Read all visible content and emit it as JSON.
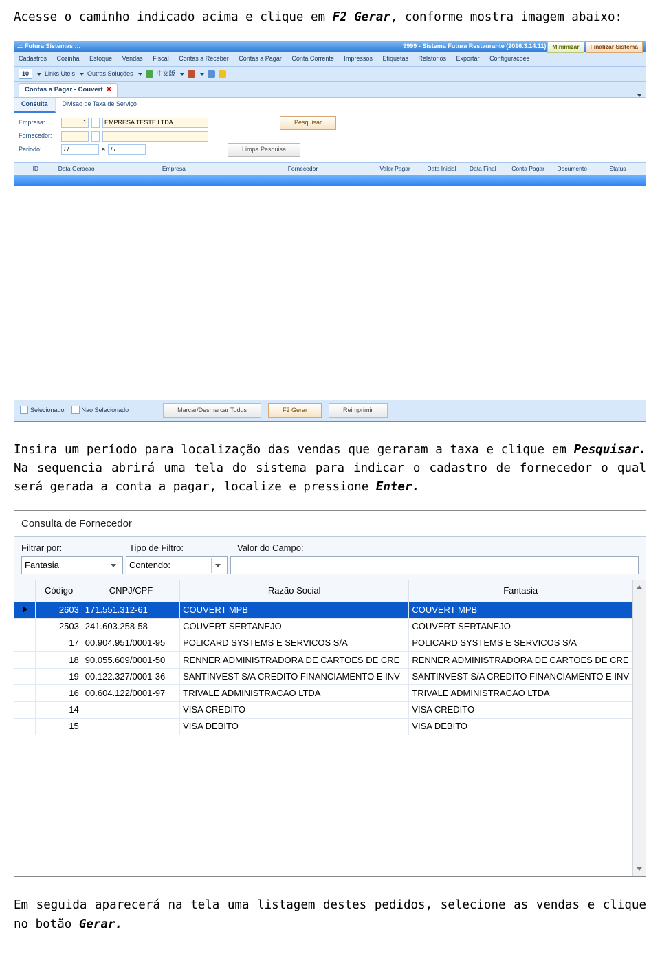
{
  "para1_a": "Acesse o caminho indicado acima e clique em ",
  "para1_b": "F2 Gerar",
  "para1_c": ", conforme mostra imagem abaixo:",
  "para2_a": "Insira um período para localização das vendas que geraram a taxa e clique em ",
  "para2_b": "Pesquisar.",
  "para2_c": " Na sequencia abrirá uma tela do sistema para indicar o cadastro de fornecedor o qual será gerada a conta a pagar, localize e pressione ",
  "para2_d": "Enter.",
  "para3_a": "Em seguida aparecerá na tela uma listagem destes pedidos, selecione as vendas e clique no botão ",
  "para3_b": "Gerar.",
  "app1": {
    "titleLeft": ".:: Futura Sistemas ::.",
    "titleRight": "9999 - Sistema Futura Restaurante (2016.3.14.11)",
    "btnMin": "Minimizar",
    "btnFin": "Finalizar Sistema",
    "menu": [
      "Cadastros",
      "Cozinha",
      "Estoque",
      "Vendas",
      "Fiscal",
      "Contas a Receber",
      "Contas a Pagar",
      "Conta Corrente",
      "Impressos",
      "Etiquetas",
      "Relatorios",
      "Exportar",
      "Configuracoes"
    ],
    "tbNum": "10",
    "tbLinks": "Links Uteis",
    "tbOutras": "Outras Soluções",
    "tbLang": "中文版",
    "tabLabel": "Contas a Pagar - Couvert",
    "subtabs": [
      "Consulta",
      "Divisao de Taxa de Serviço"
    ],
    "lblEmpresa": "Empresa:",
    "valEmpresaId": "1",
    "valEmpresa": "EMPRESA TESTE LTDA",
    "lblForn": "Fornecedor:",
    "lblPeriodo": "Periodo:",
    "valDate1": "/  /",
    "lblA": "a",
    "valDate2": "/  /",
    "btnPesq": "Pesquisar",
    "btnLimpa": "Limpa Pesquisa",
    "gridCols": [
      "ID",
      "Data Geracao",
      "Empresa",
      "Fornecedor",
      "Valor Pagar",
      "Data Inicial",
      "Data Final",
      "Conta Pagar",
      "Documento",
      "Status"
    ],
    "chkSel": "Selecionado",
    "chkNao": "Nao Selecionado",
    "btnMarcar": "Marcar/Desmarcar Todos",
    "btnGerar": "F2 Gerar",
    "btnReimp": "Reimprimir"
  },
  "app2": {
    "title": "Consulta de Fornecedor",
    "lblFiltrar": "Filtrar por:",
    "lblTipo": "Tipo de Filtro:",
    "lblValor": "Valor do Campo:",
    "combo1": "Fantasia",
    "combo2": "Contendo:",
    "cols": [
      "Código",
      "CNPJ/CPF",
      "Razão Social",
      "Fantasia"
    ],
    "rows": [
      {
        "code": "2603",
        "doc": "171.551.312-61",
        "rs": "COUVERT MPB",
        "fan": "COUVERT MPB"
      },
      {
        "code": "2503",
        "doc": "241.603.258-58",
        "rs": "COUVERT SERTANEJO",
        "fan": "COUVERT SERTANEJO"
      },
      {
        "code": "17",
        "doc": "00.904.951/0001-95",
        "rs": "POLICARD SYSTEMS E SERVICOS S/A",
        "fan": "POLICARD SYSTEMS E SERVICOS S/A"
      },
      {
        "code": "18",
        "doc": "90.055.609/0001-50",
        "rs": "RENNER ADMINISTRADORA DE CARTOES DE CRE",
        "fan": "RENNER ADMINISTRADORA DE CARTOES DE CRE"
      },
      {
        "code": "19",
        "doc": "00.122.327/0001-36",
        "rs": "SANTINVEST S/A CREDITO FINANCIAMENTO E INV",
        "fan": "SANTINVEST S/A CREDITO FINANCIAMENTO E INV"
      },
      {
        "code": "16",
        "doc": "00.604.122/0001-97",
        "rs": "TRIVALE ADMINISTRACAO LTDA",
        "fan": "TRIVALE ADMINISTRACAO LTDA"
      },
      {
        "code": "14",
        "doc": "",
        "rs": "VISA CREDITO",
        "fan": "VISA CREDITO"
      },
      {
        "code": "15",
        "doc": "",
        "rs": "VISA DEBITO",
        "fan": "VISA DEBITO"
      }
    ]
  }
}
